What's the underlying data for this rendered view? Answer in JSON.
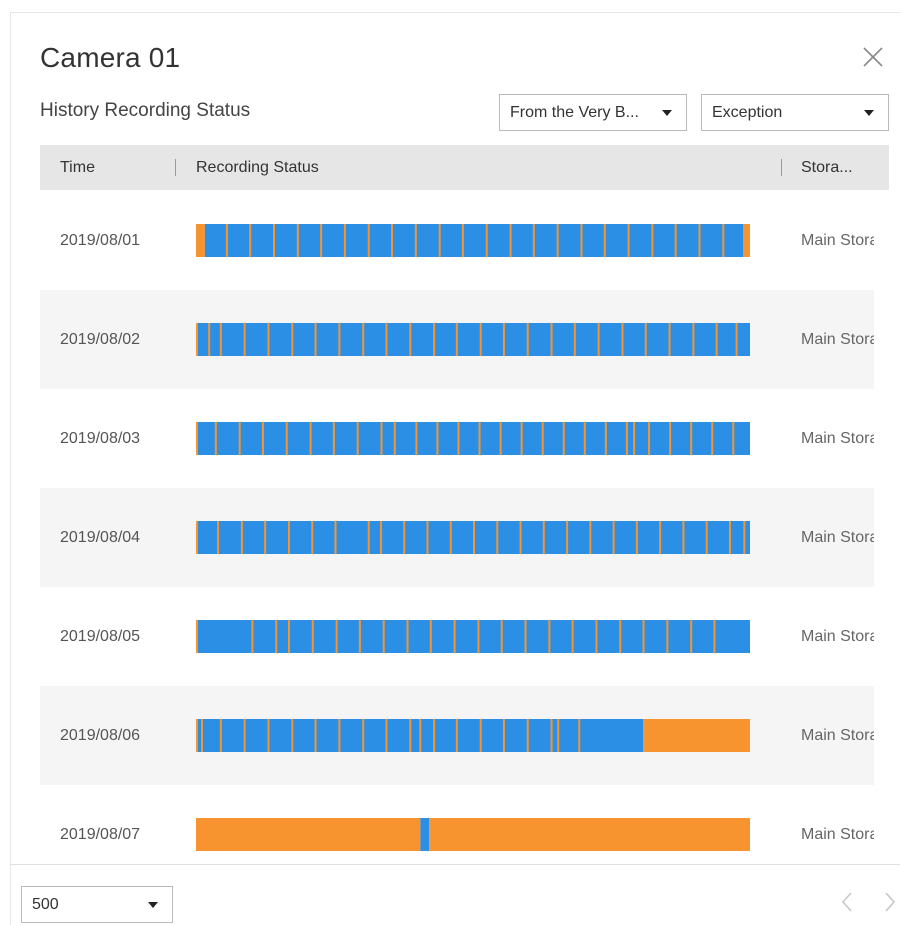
{
  "dialog": {
    "title": "Camera 01",
    "subtitle": "History Recording Status",
    "close_icon": "close-icon"
  },
  "filters": {
    "range_value": "From the Very B...",
    "type_value": "Exception"
  },
  "table": {
    "columns": [
      "Time",
      "Recording Status",
      "Stora..."
    ],
    "colors": {
      "recording": "#2b8fe5",
      "exception": "#f7942f"
    },
    "rows": [
      {
        "date": "2019/08/01",
        "storage": "Main Storage",
        "segments": [
          [
            0,
            1.6,
            "exception"
          ],
          [
            1.6,
            98.8,
            "recording"
          ],
          [
            98.8,
            100,
            "exception"
          ]
        ],
        "ticks": [
          5.4,
          9.6,
          13.9,
          18.2,
          22.4,
          26.7,
          31.0,
          35.2,
          39.5,
          43.8,
          48.0,
          52.3,
          56.6,
          60.8,
          65.1,
          69.4,
          73.6,
          77.9,
          82.2,
          86.4,
          90.7,
          95.0
        ]
      },
      {
        "date": "2019/08/02",
        "storage": "Main Storage",
        "segments": [
          [
            0,
            100,
            "recording"
          ]
        ],
        "ticks": [
          0,
          2.2,
          4.3,
          8.6,
          12.9,
          17.2,
          21.4,
          25.7,
          30.0,
          34.2,
          38.5,
          42.8,
          46.9,
          51.2,
          55.4,
          59.7,
          64.0,
          68.2,
          72.5,
          76.8,
          81.0,
          85.3,
          89.6,
          93.8,
          97.4
        ]
      },
      {
        "date": "2019/08/03",
        "storage": "Main Storage",
        "segments": [
          [
            0,
            100,
            "recording"
          ]
        ],
        "ticks": [
          0,
          3.4,
          7.7,
          11.9,
          16.2,
          20.5,
          24.7,
          29.0,
          33.3,
          35.7,
          39.6,
          43.4,
          47.2,
          51.0,
          54.8,
          58.6,
          62.4,
          66.2,
          70.0,
          73.8,
          77.6,
          78.9,
          81.6,
          85.4,
          89.2,
          93.0,
          96.8
        ]
      },
      {
        "date": "2019/08/04",
        "storage": "Main Storage",
        "segments": [
          [
            0,
            100,
            "recording"
          ]
        ],
        "ticks": [
          0,
          3.8,
          8.1,
          12.3,
          16.6,
          20.8,
          25.0,
          31.0,
          33.2,
          37.4,
          41.6,
          45.8,
          50.0,
          54.2,
          58.4,
          62.6,
          66.8,
          71.0,
          75.2,
          79.4,
          83.6,
          87.8,
          92.0,
          96.2,
          98.8
        ]
      },
      {
        "date": "2019/08/05",
        "storage": "Main Storage",
        "segments": [
          [
            0,
            100,
            "recording"
          ]
        ],
        "ticks": [
          0,
          10.0,
          14.3,
          16.6,
          20.9,
          25.2,
          29.4,
          33.7,
          38.0,
          42.2,
          46.5,
          50.8,
          55.0,
          59.3,
          63.6,
          67.8,
          72.1,
          76.4,
          80.6,
          84.9,
          89.2,
          93.4
        ]
      },
      {
        "date": "2019/08/06",
        "storage": "Main Storage",
        "segments": [
          [
            0,
            80.7,
            "recording"
          ],
          [
            80.7,
            100,
            "exception"
          ]
        ],
        "ticks": [
          0,
          0.9,
          4.3,
          8.6,
          12.9,
          17.2,
          21.4,
          25.7,
          30.0,
          34.2,
          38.5,
          40.3,
          42.8,
          46.9,
          51.2,
          55.4,
          59.7,
          64.0,
          65.2,
          69.0
        ]
      },
      {
        "date": "2019/08/07",
        "storage": "Main Storage",
        "segments": [
          [
            0,
            40.5,
            "exception"
          ],
          [
            40.5,
            42.1,
            "recording"
          ],
          [
            42.1,
            100,
            "exception"
          ]
        ],
        "ticks": []
      }
    ]
  },
  "pagination": {
    "page_size": "500",
    "prev_icon": "chevron-left-icon",
    "next_icon": "chevron-right-icon"
  }
}
